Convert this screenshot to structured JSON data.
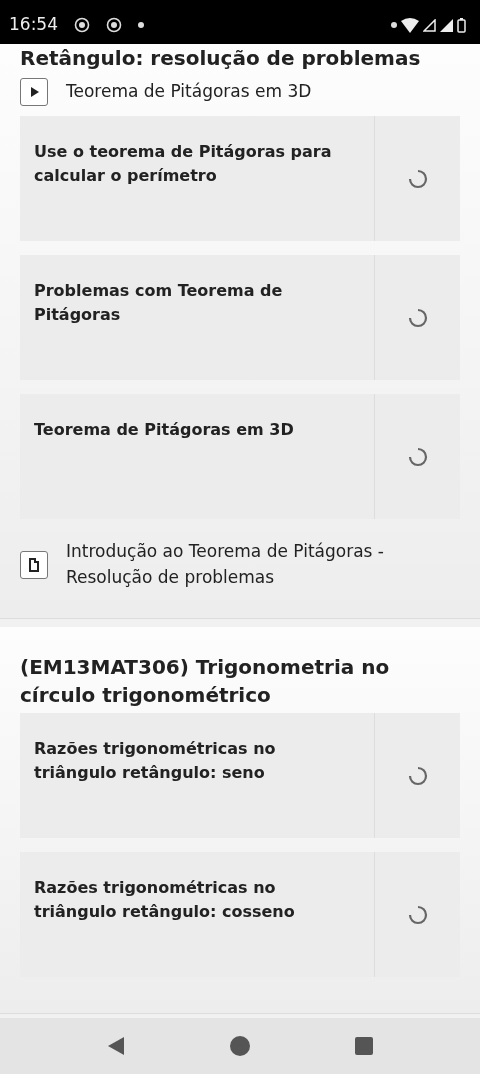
{
  "status_bar": {
    "time": "16:54"
  },
  "sections": [
    {
      "title": "Retângulo: resolução de problemas",
      "items": [
        {
          "kind": "video",
          "label": "Teorema de Pitágoras em 3D"
        },
        {
          "kind": "activity",
          "label": "Use o teorema de Pitágoras para calcular o perímetro"
        },
        {
          "kind": "activity",
          "label": "Problemas com Teorema de Pitágoras"
        },
        {
          "kind": "activity",
          "label": "Teorema de Pitágoras em 3D"
        },
        {
          "kind": "document",
          "label": "Introdução ao Teorema de Pitágoras - Resolução de problemas"
        }
      ]
    },
    {
      "title": "(EM13MAT306) Trigonometria no círculo trigonométrico",
      "items": [
        {
          "kind": "activity",
          "label": "Razões trigonométricas no triângulo retângulo: seno"
        },
        {
          "kind": "activity",
          "label": "Razões trigonométricas no triângulo retângulo: cosseno"
        }
      ]
    }
  ]
}
